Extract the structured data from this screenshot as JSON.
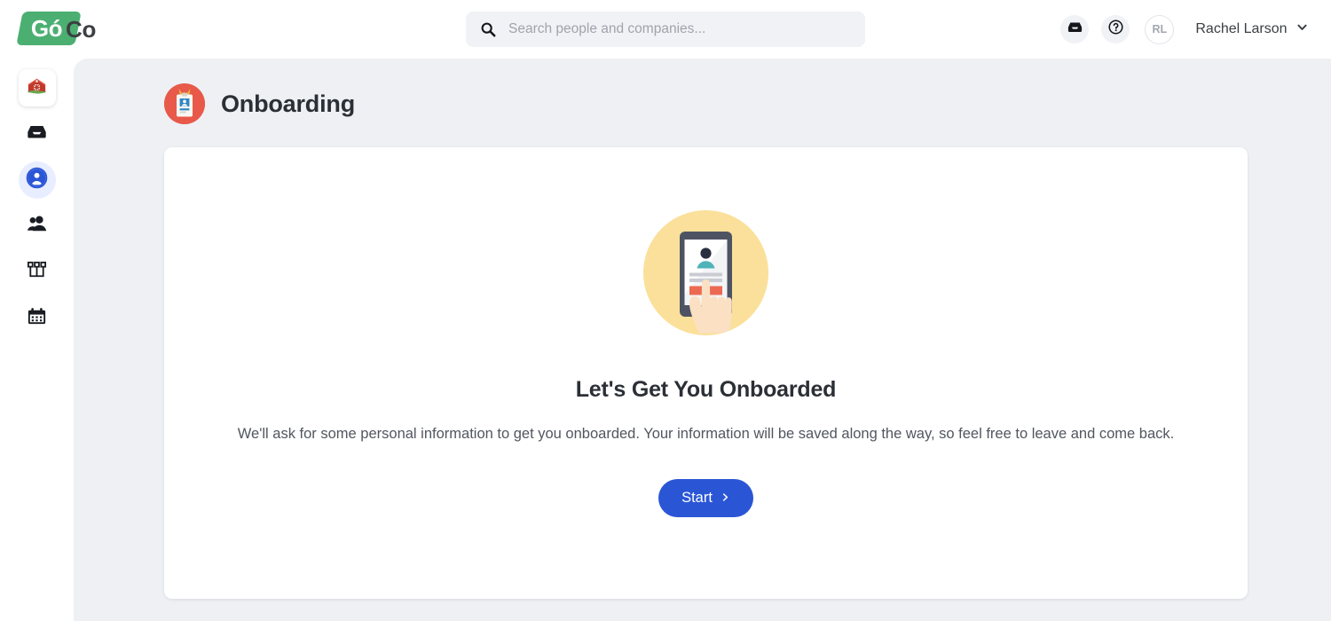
{
  "brand": {
    "logo_go": "Gó",
    "logo_go_text": "G",
    "logo_co": "Co",
    "logo_name": "GoCo",
    "green": "#4caf72"
  },
  "search": {
    "placeholder": "Search people and companies...",
    "value": "",
    "icon": "search-icon"
  },
  "header": {
    "inbox_icon": "inbox-icon",
    "help_icon": "help-circle-icon",
    "avatar_initials": "RL",
    "user_name": "Rachel Larson",
    "chevron": "⌄"
  },
  "sidebar": {
    "items": [
      {
        "name": "home",
        "icon": "barn-home-icon",
        "active": false,
        "boxed": true
      },
      {
        "name": "inbox",
        "icon": "inbox-icon",
        "active": false,
        "boxed": false
      },
      {
        "name": "my-profile",
        "icon": "person-circle-icon",
        "active": true,
        "boxed": false
      },
      {
        "name": "team",
        "icon": "people-icon",
        "active": false,
        "boxed": false
      },
      {
        "name": "org-chart",
        "icon": "org-chart-icon",
        "active": false,
        "boxed": false
      },
      {
        "name": "calendar",
        "icon": "calendar-icon",
        "active": false,
        "boxed": false
      }
    ]
  },
  "page": {
    "title": "Onboarding",
    "icon": "id-badge-icon",
    "icon_color": "#e8594a"
  },
  "card": {
    "illustration": "phone-tap-illustration",
    "illustration_bg": "#fae09a",
    "title": "Let's Get You Onboarded",
    "body": "We'll ask for some personal information to get you onboarded. Your information will be saved along the way, so feel free to leave and come back.",
    "start_label": "Start",
    "start_arrow": "›",
    "start_color": "#2a56d6"
  }
}
